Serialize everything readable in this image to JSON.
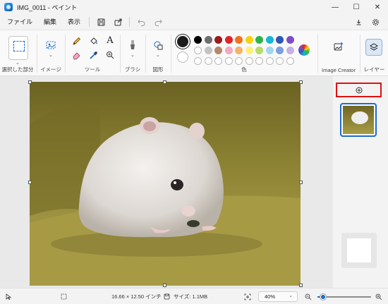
{
  "window": {
    "title": "IMG_0011 - ペイント",
    "minimize_glyph": "—",
    "maximize_glyph": "☐",
    "close_glyph": "✕"
  },
  "menu": {
    "file": "ファイル",
    "edit": "編集",
    "view": "表示"
  },
  "ribbon": {
    "selection_label": "選択した部分",
    "image_label": "イメージ",
    "tools_label": "ツール",
    "brushes_label": "ブラシ",
    "shapes_label": "図形",
    "colors_label": "色",
    "image_creator_label": "Image Creator",
    "layers_label": "レイヤー",
    "current_color_primary": "#1b1b1b",
    "current_color_secondary": "#ffffff",
    "palette_row1": [
      "#000000",
      "#6e6e6e",
      "#9b1c1c",
      "#e32227",
      "#f2711c",
      "#f5d40f",
      "#2fb34a",
      "#17b5d6",
      "#2f57b5",
      "#7b4fc4"
    ],
    "palette_row2": [
      "#ffffff",
      "#c3c3c3",
      "#b8866b",
      "#f2a8bd",
      "#f6b26b",
      "#fff07a",
      "#b6dc6a",
      "#9fd7f0",
      "#7f9de0",
      "#c7b1e3"
    ],
    "palette_row3": [
      "",
      "",
      "",
      "",
      "",
      "",
      "",
      "",
      "",
      ""
    ]
  },
  "status": {
    "dimensions": "16.66 × 12.50 インチ",
    "size": "サイズ: 1.1MB",
    "zoom": "40%",
    "zoom_level_percent": 40
  }
}
